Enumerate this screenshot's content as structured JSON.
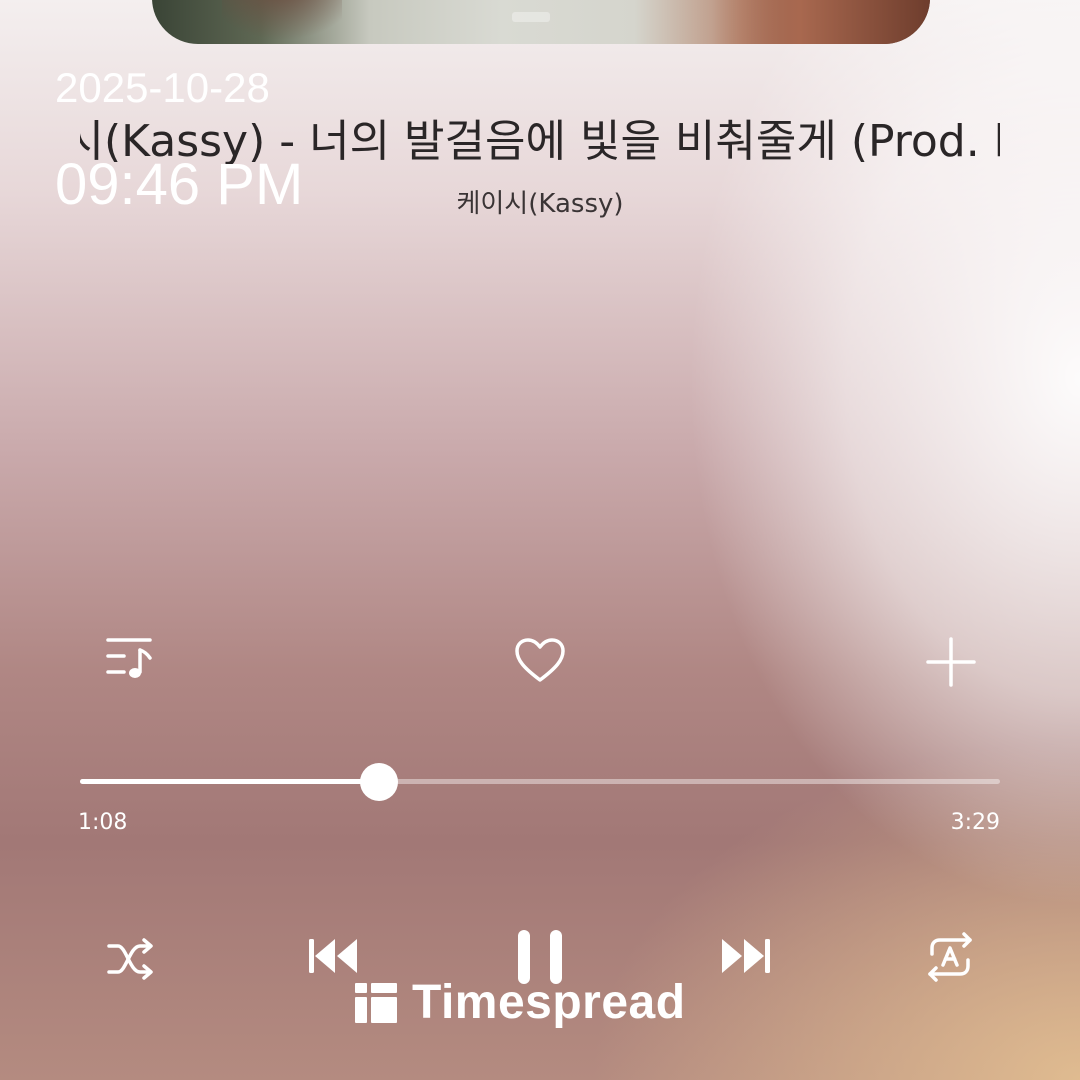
{
  "overlay": {
    "date": "2025-10-28",
    "time": "09:46 PM"
  },
  "track": {
    "title": "케이시(Kassy) - 너의 발걸음에 빛을 비춰줄게 (Prod. by 조영수)",
    "artist": "케이시(Kassy)",
    "elapsed": "1:08",
    "duration": "3:29",
    "progress_fraction": 0.325
  },
  "actions": {
    "playlist_icon": "playlist-music-icon",
    "like_icon": "heart-outline-icon",
    "add_icon": "plus-icon"
  },
  "controls": {
    "shuffle_icon": "shuffle-icon",
    "previous_icon": "skip-previous-icon",
    "play_pause_icon": "pause-icon",
    "next_icon": "skip-next-icon",
    "repeat_icon": "repeat-a-icon"
  },
  "watermark": {
    "text": "Timespread"
  },
  "colors": {
    "foreground": "#ffffff",
    "title_text": "#2a2627",
    "bg_mauve": "#a27876",
    "bg_cream": "#e2be91"
  }
}
